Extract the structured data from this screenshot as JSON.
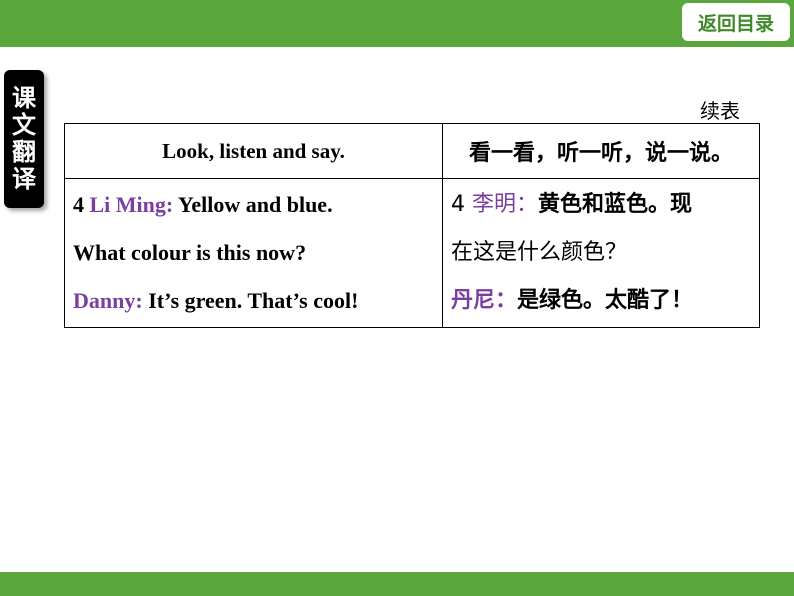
{
  "header": {
    "back_label": "返回目录"
  },
  "side_tab": {
    "label": "课文翻译"
  },
  "continued_label": "续表",
  "table": {
    "head_en": "Look, listen and say.",
    "head_zh": "看一看，听一听，说一说。",
    "en": {
      "num": "4 ",
      "speaker1": "Li Ming:",
      "line1": " Yellow and blue.",
      "line2": "What colour is this now?",
      "speaker2": "Danny:",
      "line3": " It’s green. That’s cool!"
    },
    "zh": {
      "num": "4 ",
      "speaker1": "李明：",
      "line1": "黄色和蓝色。现",
      "line2": "在这是什么颜色？",
      "speaker2": "丹尼：",
      "line3": "是绿色。太酷了！"
    }
  },
  "colors": {
    "brand_green": "#5aa63c",
    "speaker_purple": "#7a3fa0"
  }
}
